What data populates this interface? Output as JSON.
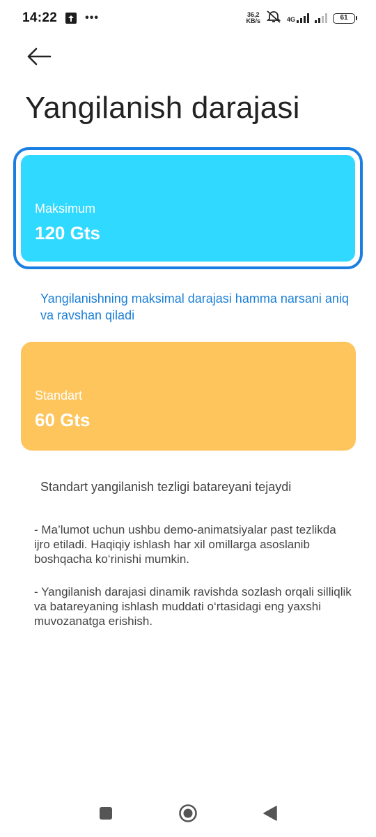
{
  "status_bar": {
    "time": "14:22",
    "speed_value": "36,2",
    "speed_unit": "KB/s",
    "network_type": "4G",
    "battery": "61"
  },
  "page": {
    "title": "Yangilanish darajasi"
  },
  "options": [
    {
      "label": "Maksimum",
      "value": "120 Gts",
      "description": "Yangilanishning maksimal darajasi hamma narsani aniq va ravshan qiladi",
      "color": "#2fd9ff",
      "selected": true
    },
    {
      "label": "Standart",
      "value": "60 Gts",
      "description": "Standart yangilanish tezligi batareyani tejaydi",
      "color": "#fdc55c",
      "selected": false
    }
  ],
  "notes": [
    "- Ma’lumot uchun ushbu demo-animatsiyalar past tezlikda ijro etiladi. Haqiqiy ishlash har xil omillarga asoslanib boshqacha ko‘rinishi mumkin.",
    "- Yangilanish darajasi dinamik ravishda sozlash orqali silliqlik va batareyaning ishlash muddati o‘rtasidagi eng yaxshi muvozanatga erishish."
  ],
  "colors": {
    "accent": "#1a7fe0",
    "accent_text": "#1a7fd6"
  },
  "icons": {
    "back": "arrow-left-icon",
    "upload": "upload-icon",
    "more": "more-dots-icon",
    "mute": "alarm-off-icon",
    "recent": "square-icon",
    "home": "circle-icon",
    "back_nav": "triangle-left-icon"
  }
}
